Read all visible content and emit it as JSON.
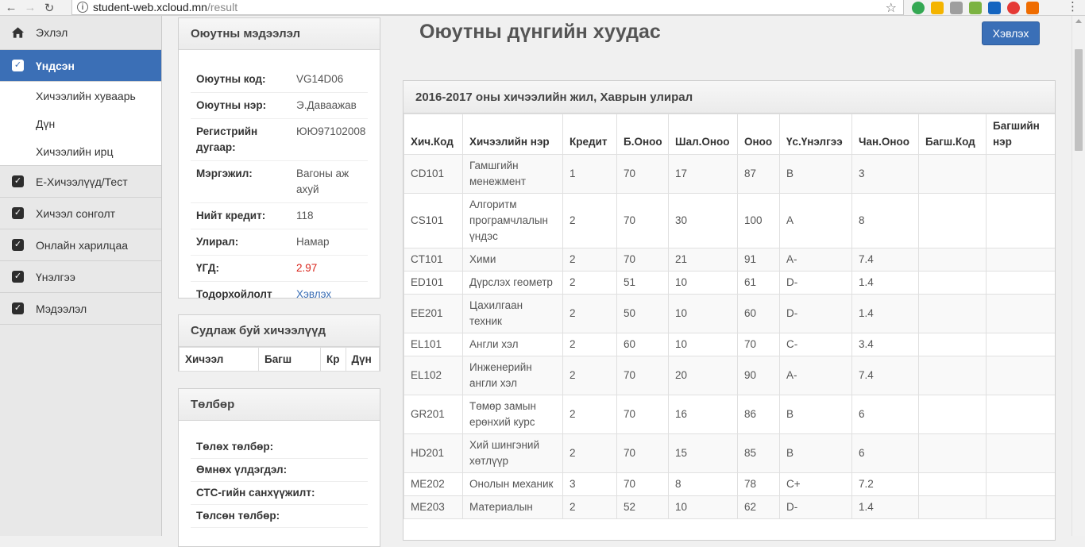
{
  "browser": {
    "url_host": "student-web.xcloud.mn",
    "url_path": "/result"
  },
  "sidebar": {
    "items": [
      {
        "label": "Эхлэл",
        "icon": "home-icon"
      },
      {
        "label": "Үндсэн",
        "icon": "checkbox-icon",
        "active": true
      },
      {
        "label": "Е-Хичээлүүд/Тест",
        "icon": "checkbox-icon"
      },
      {
        "label": "Хичээл сонголт",
        "icon": "checkbox-icon"
      },
      {
        "label": "Онлайн харилцаа",
        "icon": "checkbox-icon"
      },
      {
        "label": "Үнэлгээ",
        "icon": "checkbox-icon"
      },
      {
        "label": "Мэдээлэл",
        "icon": "checkbox-icon"
      }
    ],
    "subitems": [
      {
        "label": "Хичээлийн хуваарь"
      },
      {
        "label": "Дүн"
      },
      {
        "label": "Хичээлийн ирц"
      }
    ]
  },
  "student_info": {
    "title": "Оюутны мэдээлэл",
    "rows": [
      {
        "label": "Оюутны код:",
        "value": "VG14D06"
      },
      {
        "label": "Оюутны нэр:",
        "value": "Э.Даваажав"
      },
      {
        "label": "Регистрийн дугаар:",
        "value": "ЮЮ97102008"
      },
      {
        "label": "Мэргэжил:",
        "value": "Вагоны аж ахуй"
      },
      {
        "label": "Нийт кредит:",
        "value": "118"
      },
      {
        "label": "Улирал:",
        "value": "Намар"
      },
      {
        "label": "ҮГД:",
        "value": "2.97"
      },
      {
        "label": "Тодорхойлолт",
        "value": "Хэвлэх"
      }
    ]
  },
  "current_courses": {
    "title": "Судлаж буй хичээлүүд",
    "headers": [
      "Хичээл",
      "Багш",
      "Кр",
      "Дүн"
    ]
  },
  "payment": {
    "title": "Төлбөр",
    "rows": [
      "Төлөх төлбөр:",
      "Өмнөх үлдэгдэл:",
      "СТС-гийн санхүүжилт:",
      "Төлсөн төлбөр:"
    ]
  },
  "main": {
    "title": "Оюутны дүнгийн хуудас",
    "print_label": "Хэвлэх"
  },
  "grades": {
    "title": "2016-2017 оны хичээлийн жил, Хаврын улирал",
    "headers": [
      "Хич.Код",
      "Хичээлийн нэр",
      "Кредит",
      "Б.Оноо",
      "Шал.Оноо",
      "Оноо",
      "Үс.Үнэлгээ",
      "Чан.Оноо",
      "Багш.Код",
      "Багшийн нэр"
    ],
    "rows": [
      [
        "CD101",
        "Гамшгийн менежмент",
        "1",
        "70",
        "17",
        "87",
        "B",
        "3",
        "",
        ""
      ],
      [
        "CS101",
        "Алгоритм програмчлалын үндэс",
        "2",
        "70",
        "30",
        "100",
        "A",
        "8",
        "",
        ""
      ],
      [
        "CT101",
        "Хими",
        "2",
        "70",
        "21",
        "91",
        "A-",
        "7.4",
        "",
        ""
      ],
      [
        "ED101",
        "Дүрслэх геометр",
        "2",
        "51",
        "10",
        "61",
        "D-",
        "1.4",
        "",
        ""
      ],
      [
        "EE201",
        "Цахилгаан техник",
        "2",
        "50",
        "10",
        "60",
        "D-",
        "1.4",
        "",
        ""
      ],
      [
        "EL101",
        "Англи хэл",
        "2",
        "60",
        "10",
        "70",
        "C-",
        "3.4",
        "",
        ""
      ],
      [
        "EL102",
        "Инженерийн англи хэл",
        "2",
        "70",
        "20",
        "90",
        "A-",
        "7.4",
        "",
        ""
      ],
      [
        "GR201",
        "Төмөр замын ерөнхий курс",
        "2",
        "70",
        "16",
        "86",
        "B",
        "6",
        "",
        ""
      ],
      [
        "HD201",
        "Хий шингэний хөтлүүр",
        "2",
        "70",
        "15",
        "85",
        "B",
        "6",
        "",
        ""
      ],
      [
        "ME202",
        "Онолын механик",
        "3",
        "70",
        "8",
        "78",
        "C+",
        "7.2",
        "",
        ""
      ],
      [
        "ME203",
        "Материалын",
        "2",
        "52",
        "10",
        "62",
        "D-",
        "1.4",
        "",
        ""
      ]
    ]
  }
}
